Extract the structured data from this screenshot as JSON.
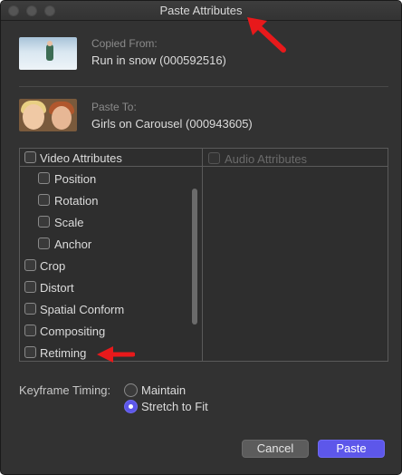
{
  "window": {
    "title": "Paste Attributes"
  },
  "copied_from": {
    "label": "Copied From:",
    "name": "Run in snow (000592516)"
  },
  "paste_to": {
    "label": "Paste To:",
    "name": "Girls on Carousel (000943605)"
  },
  "video_attributes": {
    "header": "Video Attributes",
    "items": [
      {
        "label": "Position",
        "indent": true
      },
      {
        "label": "Rotation",
        "indent": true
      },
      {
        "label": "Scale",
        "indent": true
      },
      {
        "label": "Anchor",
        "indent": true
      },
      {
        "label": "Crop",
        "indent": false
      },
      {
        "label": "Distort",
        "indent": false
      },
      {
        "label": "Spatial Conform",
        "indent": false
      },
      {
        "label": "Compositing",
        "indent": false
      },
      {
        "label": "Retiming",
        "indent": false
      }
    ]
  },
  "audio_attributes": {
    "header": "Audio Attributes"
  },
  "keyframe_timing": {
    "label": "Keyframe Timing:",
    "options": [
      "Maintain",
      "Stretch to Fit"
    ],
    "selected": "Stretch to Fit"
  },
  "buttons": {
    "cancel": "Cancel",
    "paste": "Paste"
  },
  "colors": {
    "accent": "#5d57ea",
    "annotation_arrow": "#e8191b"
  }
}
